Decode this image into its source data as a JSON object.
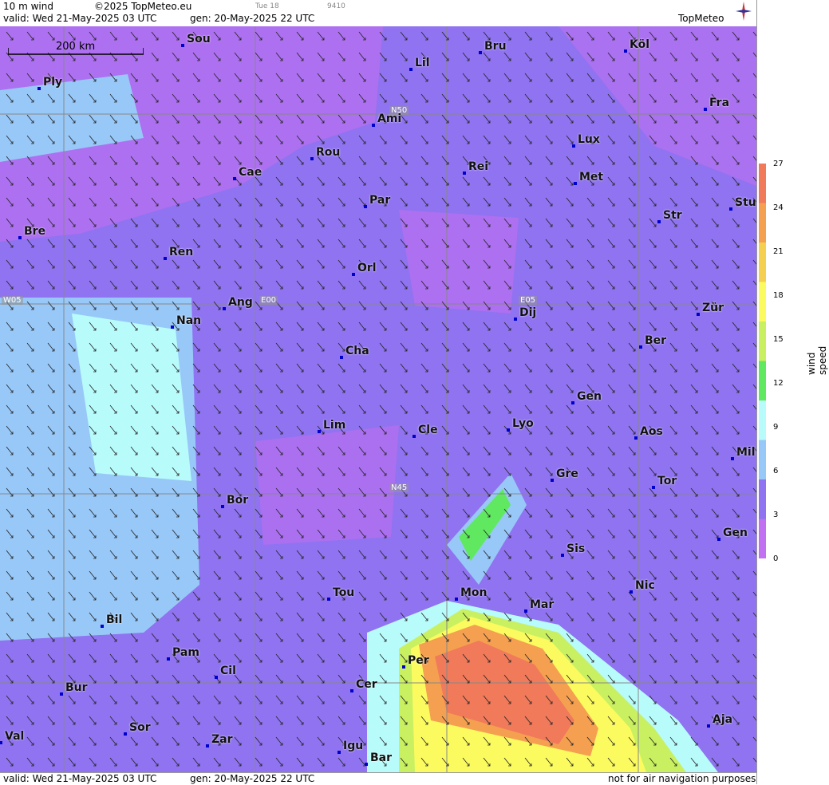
{
  "header": {
    "field": "10 m wind",
    "copyright": "©2025 TopMeteo.eu",
    "small_day": "Tue 18",
    "small_code": "9410",
    "valid": "valid:  Wed  21-May-2025  03 UTC",
    "gen": "gen: 20-May-2025 22 UTC",
    "brand": "TopMeteo"
  },
  "footer": {
    "valid": "valid:  Wed  21-May-2025  03 UTC",
    "gen": "gen: 20-May-2025 22 UTC",
    "disclaimer": "not for air navigation purposes"
  },
  "scale_label": "200 km",
  "legend": {
    "title": "wind speed [kt]",
    "ticks": [
      "27",
      "24",
      "21",
      "18",
      "15",
      "12",
      "9",
      "6",
      "3",
      "0"
    ],
    "colors": [
      "#f07a5a",
      "#f5a050",
      "#f5d050",
      "#fbfb60",
      "#c8f060",
      "#60e860",
      "#b8fbfb",
      "#98c8f8",
      "#8f73f0",
      "#c070f0"
    ]
  },
  "grid_labels": [
    "N50",
    "N45",
    "W05",
    "E00",
    "E05"
  ],
  "cities": [
    "Sou",
    "Bru",
    "Köl",
    "Ply",
    "Lil",
    "Ami",
    "Fra",
    "Lux",
    "Rou",
    "Cae",
    "Rei",
    "Met",
    "Par",
    "Stu",
    "Str",
    "Bre",
    "Ren",
    "Orl",
    "Ang",
    "Dij",
    "Zür",
    "Nan",
    "Ber",
    "Cha",
    "Gen",
    "Lim",
    "Cle",
    "Lyo",
    "Aos",
    "Mil",
    "Gre",
    "Tor",
    "Bor",
    "Sis",
    "Gen",
    "Tou",
    "Nic",
    "Mon",
    "Mar",
    "Bil",
    "Pam",
    "Cil",
    "Per",
    "Bur",
    "Cer",
    "Aja",
    "Val",
    "Sor",
    "Zar",
    "Igu",
    "Bar"
  ]
}
